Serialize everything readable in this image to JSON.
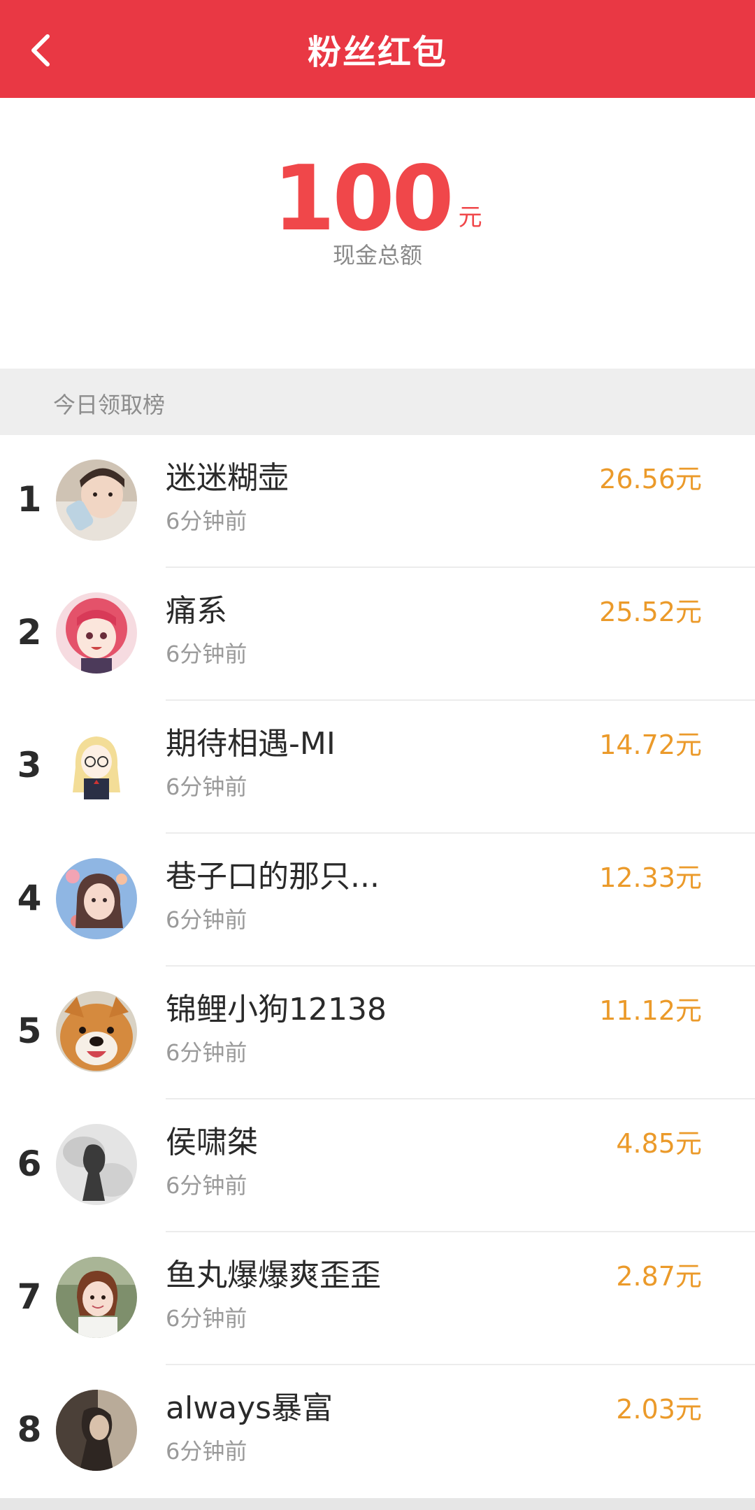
{
  "header": {
    "title": "粉丝红包"
  },
  "summary": {
    "amount": "100",
    "unit": "元",
    "label": "现金总额"
  },
  "section": {
    "title": "今日领取榜"
  },
  "ranking": [
    {
      "rank": "1",
      "name": "迷迷糊壶",
      "time": "6分钟前",
      "amount": "26.56元",
      "avatar": "baby-photo"
    },
    {
      "rank": "2",
      "name": "痛系",
      "time": "6分钟前",
      "amount": "25.52元",
      "avatar": "anime-girl-pink-hair"
    },
    {
      "rank": "3",
      "name": "期待相遇-MI",
      "time": "6分钟前",
      "amount": "14.72元",
      "avatar": "cartoon-blonde-girl"
    },
    {
      "rank": "4",
      "name": "巷子口的那只...",
      "time": "6分钟前",
      "amount": "12.33元",
      "avatar": "illustrated-girl-flowers"
    },
    {
      "rank": "5",
      "name": "锦鲤小狗12138",
      "time": "6分钟前",
      "amount": "11.12元",
      "avatar": "shiba-dog-photo"
    },
    {
      "rank": "6",
      "name": "侯啸桀",
      "time": "6分钟前",
      "amount": "4.85元",
      "avatar": "ink-silhouette"
    },
    {
      "rank": "7",
      "name": "鱼丸爆爆爽歪歪",
      "time": "6分钟前",
      "amount": "2.87元",
      "avatar": "girl-outdoor-photo"
    },
    {
      "rank": "8",
      "name": "always暴富",
      "time": "6分钟前",
      "amount": "2.03元",
      "avatar": "dark-portrait-photo"
    }
  ],
  "colors": {
    "header_bg": "#e93844",
    "amount_red": "#f0474a",
    "received_orange": "#eb9a2a",
    "section_bg": "#eeeeee"
  }
}
